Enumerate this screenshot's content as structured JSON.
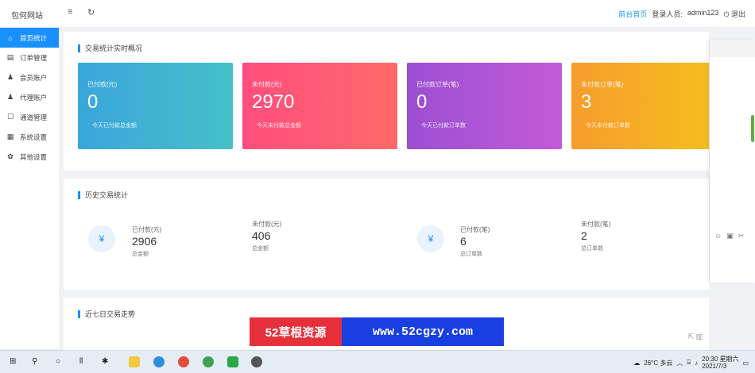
{
  "header": {
    "logo": "包何网站",
    "menu_icon": "≡",
    "refresh_icon": "↻",
    "home_link": "前台首页",
    "login_label": "登录人员:",
    "user": "admin123",
    "logout": "退出"
  },
  "sidebar": {
    "items": [
      {
        "icon": "home-icon",
        "glyph": "⌂",
        "label": "首页统计"
      },
      {
        "icon": "order-icon",
        "glyph": "▤",
        "label": "订单管理"
      },
      {
        "icon": "user-icon",
        "glyph": "♟",
        "label": "会员账户"
      },
      {
        "icon": "agent-icon",
        "glyph": "♟",
        "label": "代理账户"
      },
      {
        "icon": "channel-icon",
        "glyph": "☐",
        "label": "通道管理"
      },
      {
        "icon": "settings-icon",
        "glyph": "▦",
        "label": "系统设置"
      },
      {
        "icon": "gear-icon",
        "glyph": "✿",
        "label": "其他设置"
      }
    ]
  },
  "overview": {
    "title": "交易统计实时概况",
    "cards": [
      {
        "label": "已付款(元)",
        "value": "0",
        "sub": "今天已付款总金额",
        "color1": "#3aa6dc",
        "color2": "#44c1c9"
      },
      {
        "label": "未付款(元)",
        "value": "2970",
        "sub": "今天未付款总金额",
        "color1": "#ff4e7e",
        "color2": "#ff6a6a"
      },
      {
        "label": "已付款订单(笔)",
        "value": "0",
        "sub": "今天已付款订单数",
        "color1": "#9b4fd1",
        "color2": "#c35bd8"
      },
      {
        "label": "未付款订单(笔)",
        "value": "3",
        "sub": "今天未付款订单数",
        "color1": "#f79c2d",
        "color2": "#f3c21b"
      }
    ]
  },
  "history": {
    "title": "历史交易统计",
    "groups": [
      {
        "icon": "yuan-icon",
        "glyph": "¥",
        "metrics": [
          {
            "label": "已付款(元)",
            "value": "2906",
            "sub": "总金额"
          },
          {
            "label": "未付款(元)",
            "value": "406",
            "sub": "总金额"
          }
        ]
      },
      {
        "icon": "yuan-icon",
        "glyph": "¥",
        "metrics": [
          {
            "label": "已付款(笔)",
            "value": "6",
            "sub": "总订单数"
          },
          {
            "label": "未付款(笔)",
            "value": "2",
            "sub": "总订单数"
          }
        ]
      }
    ]
  },
  "trend": {
    "title": "近七日交易走势"
  },
  "watermark": {
    "cn": "52草根资源",
    "url": "www.52cgzy.com"
  },
  "taskbar": {
    "weather": "26°C 多云",
    "time": "20:30",
    "day": "星期六",
    "date": "2021/7/3"
  }
}
